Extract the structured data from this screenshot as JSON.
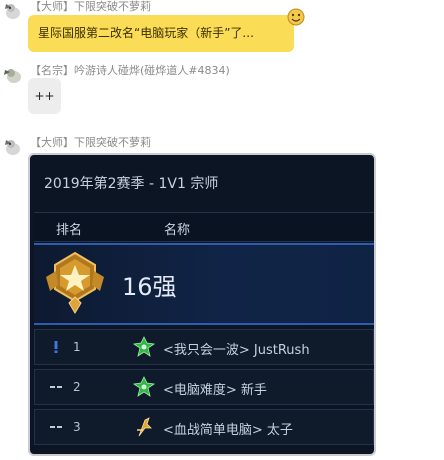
{
  "messages": [
    {
      "sender": "【大师】下限突破不萝莉",
      "text": "星际国服第二改名“电脑玩家（新手”了..."
    },
    {
      "sender": "【名宗】吟游诗人碰烨(碰烨道人#4834)",
      "text": "++"
    },
    {
      "sender": "【大师】下限突破不萝莉"
    }
  ],
  "panel": {
    "title": "2019年第2赛季 - 1V1 宗师",
    "columns": {
      "rank": "排名",
      "name": "名称"
    },
    "tier_label": "16强",
    "rows": [
      {
        "rank": "1",
        "name": "<我只会一波> JustRush",
        "race_icon": "zerg-icon",
        "change_icon": "exclamation-icon"
      },
      {
        "rank": "2",
        "name": "<电脑难度> 新手",
        "race_icon": "zerg-icon",
        "change_icon": "dash-icon"
      },
      {
        "rank": "3",
        "name": "<血战简单电脑> 太子",
        "race_icon": "protoss-icon",
        "change_icon": "dash-icon"
      }
    ]
  },
  "colors": {
    "bubble_yellow": "#fbdc57",
    "bubble_gray": "#ededed",
    "panel_bg": "#0c1524",
    "tier_border": "#2f5bb0"
  }
}
